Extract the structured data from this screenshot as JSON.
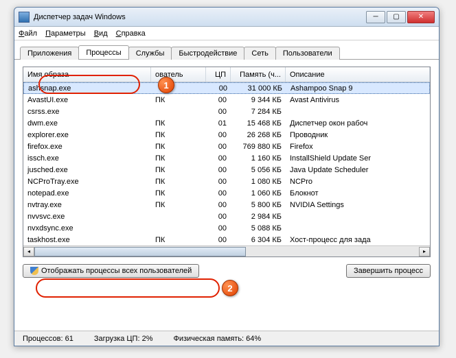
{
  "window": {
    "title": "Диспетчер задач Windows"
  },
  "menu": {
    "file": "Файл",
    "options": "Параметры",
    "view": "Вид",
    "help": "Справка"
  },
  "tabs": {
    "apps": "Приложения",
    "processes": "Процессы",
    "services": "Службы",
    "performance": "Быстродействие",
    "network": "Сеть",
    "users": "Пользователи"
  },
  "columns": {
    "image": "Имя образа",
    "user": "ователь",
    "cpu": "ЦП",
    "memory": "Память (ч...",
    "desc": "Описание"
  },
  "rows": [
    {
      "img": "ashsnap.exe",
      "user": "",
      "cpu": "00",
      "mem": "31 000 КБ",
      "desc": "Ashampoo Snap 9",
      "selected": true
    },
    {
      "img": "AvastUI.exe",
      "user": "ПК",
      "cpu": "00",
      "mem": "9 344 КБ",
      "desc": "Avast Antivirus"
    },
    {
      "img": "csrss.exe",
      "user": "",
      "cpu": "00",
      "mem": "7 284 КБ",
      "desc": ""
    },
    {
      "img": "dwm.exe",
      "user": "ПК",
      "cpu": "01",
      "mem": "15 468 КБ",
      "desc": "Диспетчер окон рабоч"
    },
    {
      "img": "explorer.exe",
      "user": "ПК",
      "cpu": "00",
      "mem": "26 268 КБ",
      "desc": "Проводник"
    },
    {
      "img": "firefox.exe",
      "user": "ПК",
      "cpu": "00",
      "mem": "769 880 КБ",
      "desc": "Firefox"
    },
    {
      "img": "issch.exe",
      "user": "ПК",
      "cpu": "00",
      "mem": "1 160 КБ",
      "desc": "InstallShield Update Ser"
    },
    {
      "img": "jusched.exe",
      "user": "ПК",
      "cpu": "00",
      "mem": "5 056 КБ",
      "desc": "Java Update Scheduler"
    },
    {
      "img": "NCProTray.exe",
      "user": "ПК",
      "cpu": "00",
      "mem": "1 080 КБ",
      "desc": "NCPro"
    },
    {
      "img": "notepad.exe",
      "user": "ПК",
      "cpu": "00",
      "mem": "1 060 КБ",
      "desc": "Блокнот"
    },
    {
      "img": "nvtray.exe",
      "user": "ПК",
      "cpu": "00",
      "mem": "5 800 КБ",
      "desc": "NVIDIA Settings"
    },
    {
      "img": "nvvsvc.exe",
      "user": "",
      "cpu": "00",
      "mem": "2 984 КБ",
      "desc": ""
    },
    {
      "img": "nvxdsync.exe",
      "user": "",
      "cpu": "00",
      "mem": "5 088 КБ",
      "desc": ""
    },
    {
      "img": "taskhost.exe",
      "user": "ПК",
      "cpu": "00",
      "mem": "6 304 КБ",
      "desc": "Хост-процесс для зада"
    }
  ],
  "buttons": {
    "show_all": "Отображать процессы всех пользователей",
    "end_process": "Завершить процесс"
  },
  "status": {
    "processes": "Процессов: 61",
    "cpu": "Загрузка ЦП: 2%",
    "memory": "Физическая память: 64%"
  },
  "annotations": {
    "a1": "1",
    "a2": "2"
  }
}
